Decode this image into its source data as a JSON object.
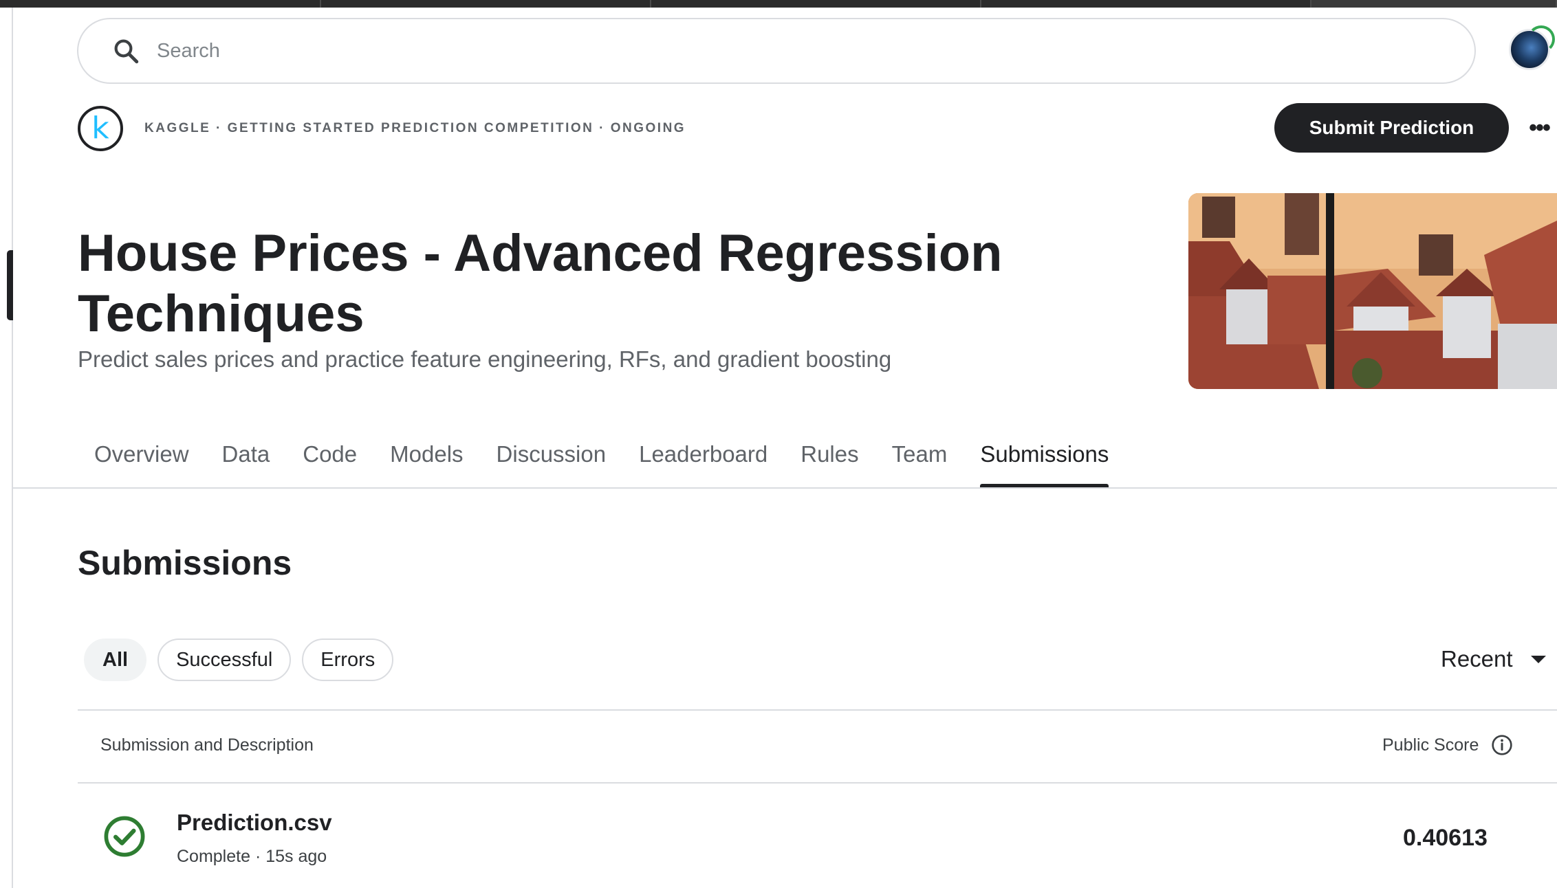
{
  "search": {
    "placeholder": "Search"
  },
  "header": {
    "logo_letter": "k",
    "kicker": "KAGGLE · GETTING STARTED PREDICTION COMPETITION · ONGOING",
    "submit_label": "Submit Prediction",
    "more_label": "•••"
  },
  "competition": {
    "title": "House Prices - Advanced Regression Techniques",
    "subtitle": "Predict sales prices and practice feature engineering, RFs, and gradient boosting"
  },
  "tabs": [
    {
      "label": "Overview"
    },
    {
      "label": "Data"
    },
    {
      "label": "Code"
    },
    {
      "label": "Models"
    },
    {
      "label": "Discussion"
    },
    {
      "label": "Leaderboard"
    },
    {
      "label": "Rules"
    },
    {
      "label": "Team"
    },
    {
      "label": "Submissions",
      "active": true
    }
  ],
  "submissions": {
    "heading": "Submissions",
    "filters": [
      {
        "label": "All",
        "active": true
      },
      {
        "label": "Successful"
      },
      {
        "label": "Errors"
      }
    ],
    "sort_label": "Recent",
    "columns": {
      "left": "Submission and Description",
      "right": "Public Score"
    },
    "rows": [
      {
        "file": "Prediction.csv",
        "meta": "Complete · 15s ago",
        "score": "0.40613",
        "status": "success"
      }
    ]
  },
  "icons": {
    "search": "search-icon",
    "info": "info-icon",
    "check": "check-circle-icon",
    "caret": "caret-down-icon"
  },
  "colors": {
    "accent": "#202124",
    "kaggle_blue": "#20beff",
    "success": "#2e7d32",
    "muted": "#5f6368",
    "border": "#dadce0"
  }
}
